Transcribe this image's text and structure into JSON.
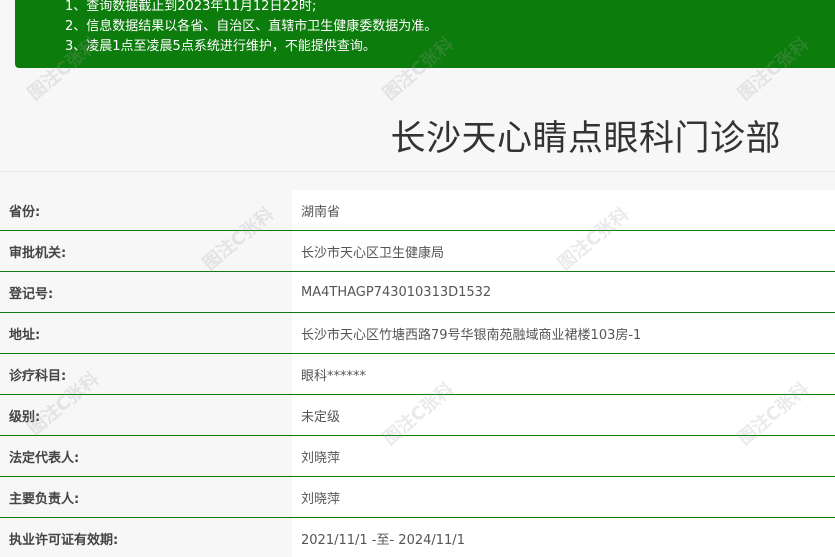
{
  "notice": {
    "lines": [
      "1、查询数据截止到2023年11月12日22时;",
      "2、信息数据结果以各省、自治区、直辖市卫生健康委数据为准。",
      "3、凌晨1点至凌晨5点系统进行维护，不能提供查询。"
    ]
  },
  "title": "长沙天心睛点眼科门诊部",
  "rows": [
    {
      "label": "省份:",
      "value": "湖南省"
    },
    {
      "label": "审批机关:",
      "value": "长沙市天心区卫生健康局"
    },
    {
      "label": "登记号:",
      "value": "MA4THAGP743010313D1532"
    },
    {
      "label": "地址:",
      "value": "长沙市天心区竹塘西路79号华银南苑融域商业裙楼103房-1"
    },
    {
      "label": "诊疗科目:",
      "value": "眼科******"
    },
    {
      "label": "级别:",
      "value": "未定级"
    },
    {
      "label": "法定代表人:",
      "value": "刘晓萍"
    },
    {
      "label": "主要负责人:",
      "value": "刘晓萍"
    },
    {
      "label": "执业许可证有效期:",
      "value": "2021/11/1 -至- 2024/11/1"
    }
  ],
  "watermark_text": "图注C张科",
  "colors": {
    "notice_bg": "#0c7c0c",
    "row_border": "#0c7c0c",
    "title_text": "#333333"
  }
}
